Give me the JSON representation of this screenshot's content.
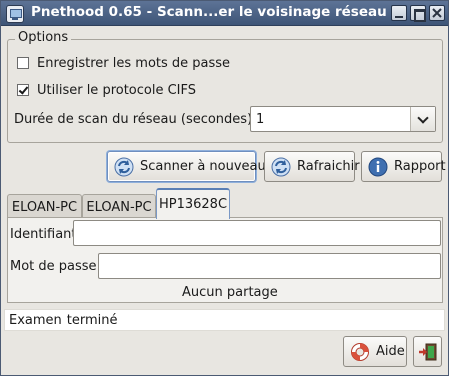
{
  "window": {
    "title": "Pnethood 0.65 - Scann...er le voisinage réseau",
    "min_icon": "minimize-icon",
    "max_icon": "maximize-icon",
    "close_icon": "close-icon"
  },
  "options": {
    "legend": "Options",
    "save_passwords": {
      "label": "Enregistrer les mots de passe",
      "checked": false
    },
    "use_cifs": {
      "label": "Utiliser le protocole CIFS",
      "checked": true
    },
    "scan_duration_label": "Durée de scan du réseau (secondes):",
    "scan_duration_value": "1"
  },
  "actions": {
    "rescan_label": "Scanner à nouveau",
    "refresh_label": "Rafraichir",
    "report_label": "Rapport"
  },
  "tabs": [
    {
      "label": "ELOAN-PC",
      "active": false
    },
    {
      "label": "ELOAN-PC",
      "active": false
    },
    {
      "label": "HP13628C",
      "active": true
    }
  ],
  "panel": {
    "identifier_label": "Identifiant",
    "identifier_value": "",
    "password_label": "Mot de passe",
    "password_value": "",
    "shares_text": "Aucun partage"
  },
  "status": {
    "word1": "Examen",
    "word2": "terminé"
  },
  "footer": {
    "help_label": "Aide",
    "exit_icon": "exit-door-icon"
  },
  "colors": {
    "titlebar": "#4a6285",
    "accent": "#5a7fb5",
    "window_bg": "#e8e6e1"
  }
}
